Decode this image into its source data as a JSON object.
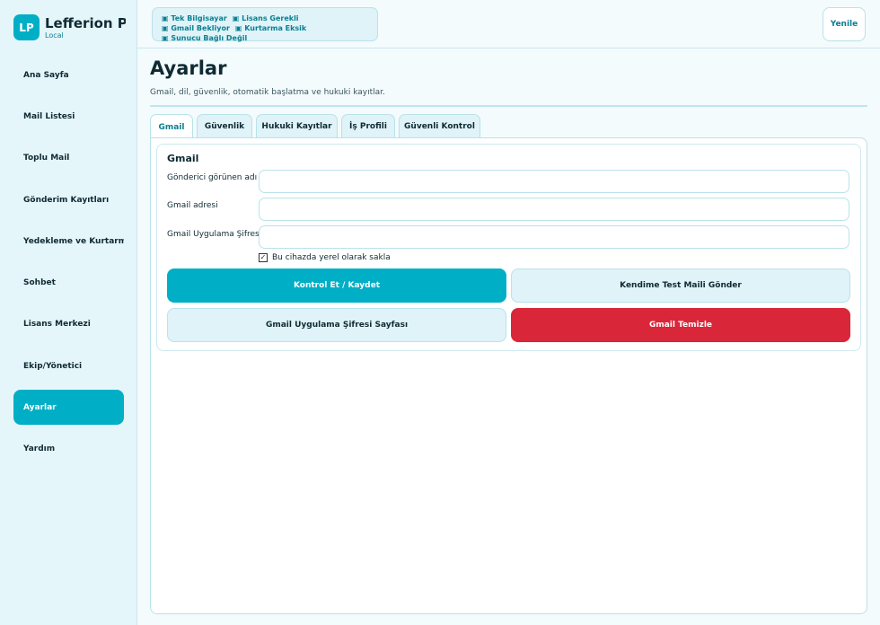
{
  "sidebar": {
    "brand_initials": "LP",
    "brand_name": "Lefferion Pro",
    "brand_sub": "Local",
    "items": [
      {
        "label": "Ana Sayfa"
      },
      {
        "label": "Mail Listesi"
      },
      {
        "label": "Toplu Mail"
      },
      {
        "label": "Gönderim Kayıtları"
      },
      {
        "label": "Yedekleme ve Kurtarma"
      },
      {
        "label": "Sohbet"
      },
      {
        "label": "Lisans Merkezi"
      },
      {
        "label": "Ekip/Yönetici"
      },
      {
        "label": "Ayarlar"
      },
      {
        "label": "Yardım"
      }
    ]
  },
  "topbar": {
    "badges": [
      "▣ Tek Bilgisayar",
      "▣ Lisans Gerekli",
      "▣ Gmail Bekliyor",
      "▣ Kurtarma Eksik",
      "▣ Sunucu Bağlı Değil"
    ],
    "refresh_label": "Yenile"
  },
  "page": {
    "title": "Ayarlar",
    "subtitle": "Gmail, dil, güvenlik, otomatik başlatma ve hukuki kayıtlar."
  },
  "tabs": [
    {
      "label": "Gmail"
    },
    {
      "label": "Güvenlik"
    },
    {
      "label": "Hukuki Kayıtlar"
    },
    {
      "label": "İş Profili"
    },
    {
      "label": "Güvenli Kontrol"
    }
  ],
  "gmail": {
    "section_title": "Gmail",
    "sender_label": "Gönderici görünen adı",
    "sender_value": "",
    "address_label": "Gmail adresi",
    "address_value": "",
    "password_label": "Gmail Uygulama Şifresi",
    "password_value": "",
    "save_locally_label": "Bu cihazda yerel olarak sakla",
    "save_locally_checked": "✓",
    "btn_check_save": "Kontrol Et / Kaydet",
    "btn_test_mail": "Kendime Test Maili Gönder",
    "btn_app_password_page": "Gmail Uygulama Şifresi Sayfası",
    "btn_clear_gmail": "Gmail Temizle"
  },
  "colors": {
    "accent": "#00afc6",
    "danger": "#d92638",
    "sidebar_bg": "#e5f6fa"
  }
}
